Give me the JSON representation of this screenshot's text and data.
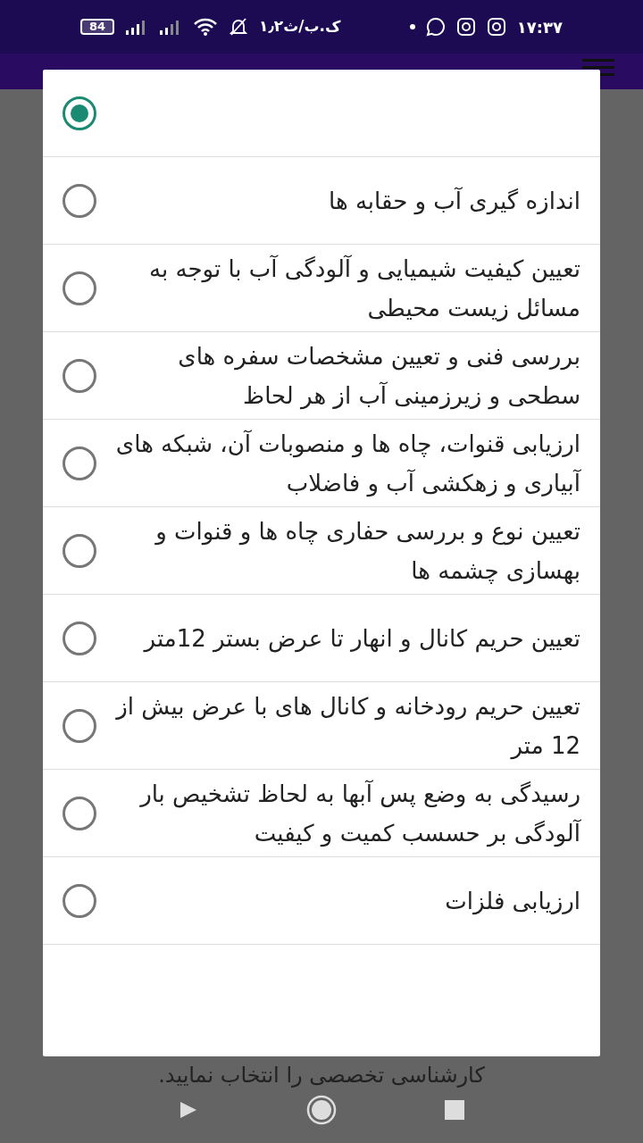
{
  "status_bar": {
    "time": "۱۷:۳۷",
    "speed": "۱٫۲ک.ب/ث",
    "battery": "84"
  },
  "options": [
    {
      "selected": true
    },
    {
      "label": "اندازه گیری آب و حقابه ها",
      "selected": false
    },
    {
      "label": "تعیین کیفیت شیمیایی و آلودگی آب با توجه به مسائل زیست محیطی",
      "selected": false
    },
    {
      "label": "بررسی فنی و تعیین مشخصات سفره های سطحی و زیرزمینی آب از هر لحاظ",
      "selected": false
    },
    {
      "label": "ارزیابی قنوات، چاه ها و منصوبات آن، شبکه های آبیاری و زهکشی آب و فاضلاب",
      "selected": false
    },
    {
      "label": "تعیین نوع و بررسی حفاری چاه ها و قنوات و بهسازی چشمه ها",
      "selected": false
    },
    {
      "label": "تعیین حریم کانال و انهار تا عرض بستر 12متر",
      "selected": false
    },
    {
      "label": "تعیین حریم رودخانه و کانال های با عرض بیش از 12 متر",
      "selected": false
    },
    {
      "label": "رسیدگی به وضع پس آبها به لحاظ تشخیص بار آلودگی بر حسسب کمیت و کیفیت",
      "selected": false
    },
    {
      "label": "ارزیابی فلزات",
      "selected": false
    }
  ],
  "background_hint": "کارشناسی تخصصی را انتخاب نمایید."
}
